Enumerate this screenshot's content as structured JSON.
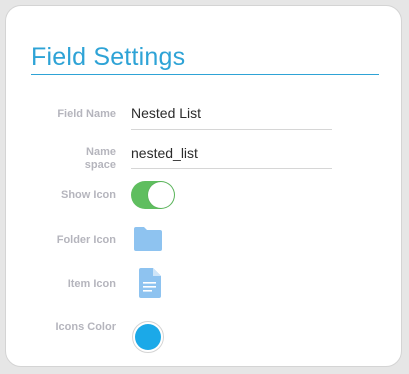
{
  "panel": {
    "title": "Field Settings"
  },
  "fields": {
    "field_name": {
      "label": "Field Name",
      "value": "Nested List"
    },
    "namespace": {
      "label": "Name space",
      "value": "nested_list"
    },
    "show_icon": {
      "label": "Show Icon",
      "checked": true
    },
    "folder_icon": {
      "label": "Folder Icon",
      "icon": "folder-icon"
    },
    "item_icon": {
      "label": "Item Icon",
      "icon": "document-icon"
    },
    "icons_color": {
      "label": "Icons Color",
      "color": "#1ba9e8"
    }
  },
  "colors": {
    "accent": "#2ea3d6",
    "toggle_on": "#5fbe5f",
    "icon_fill": "#8ec3f0"
  }
}
